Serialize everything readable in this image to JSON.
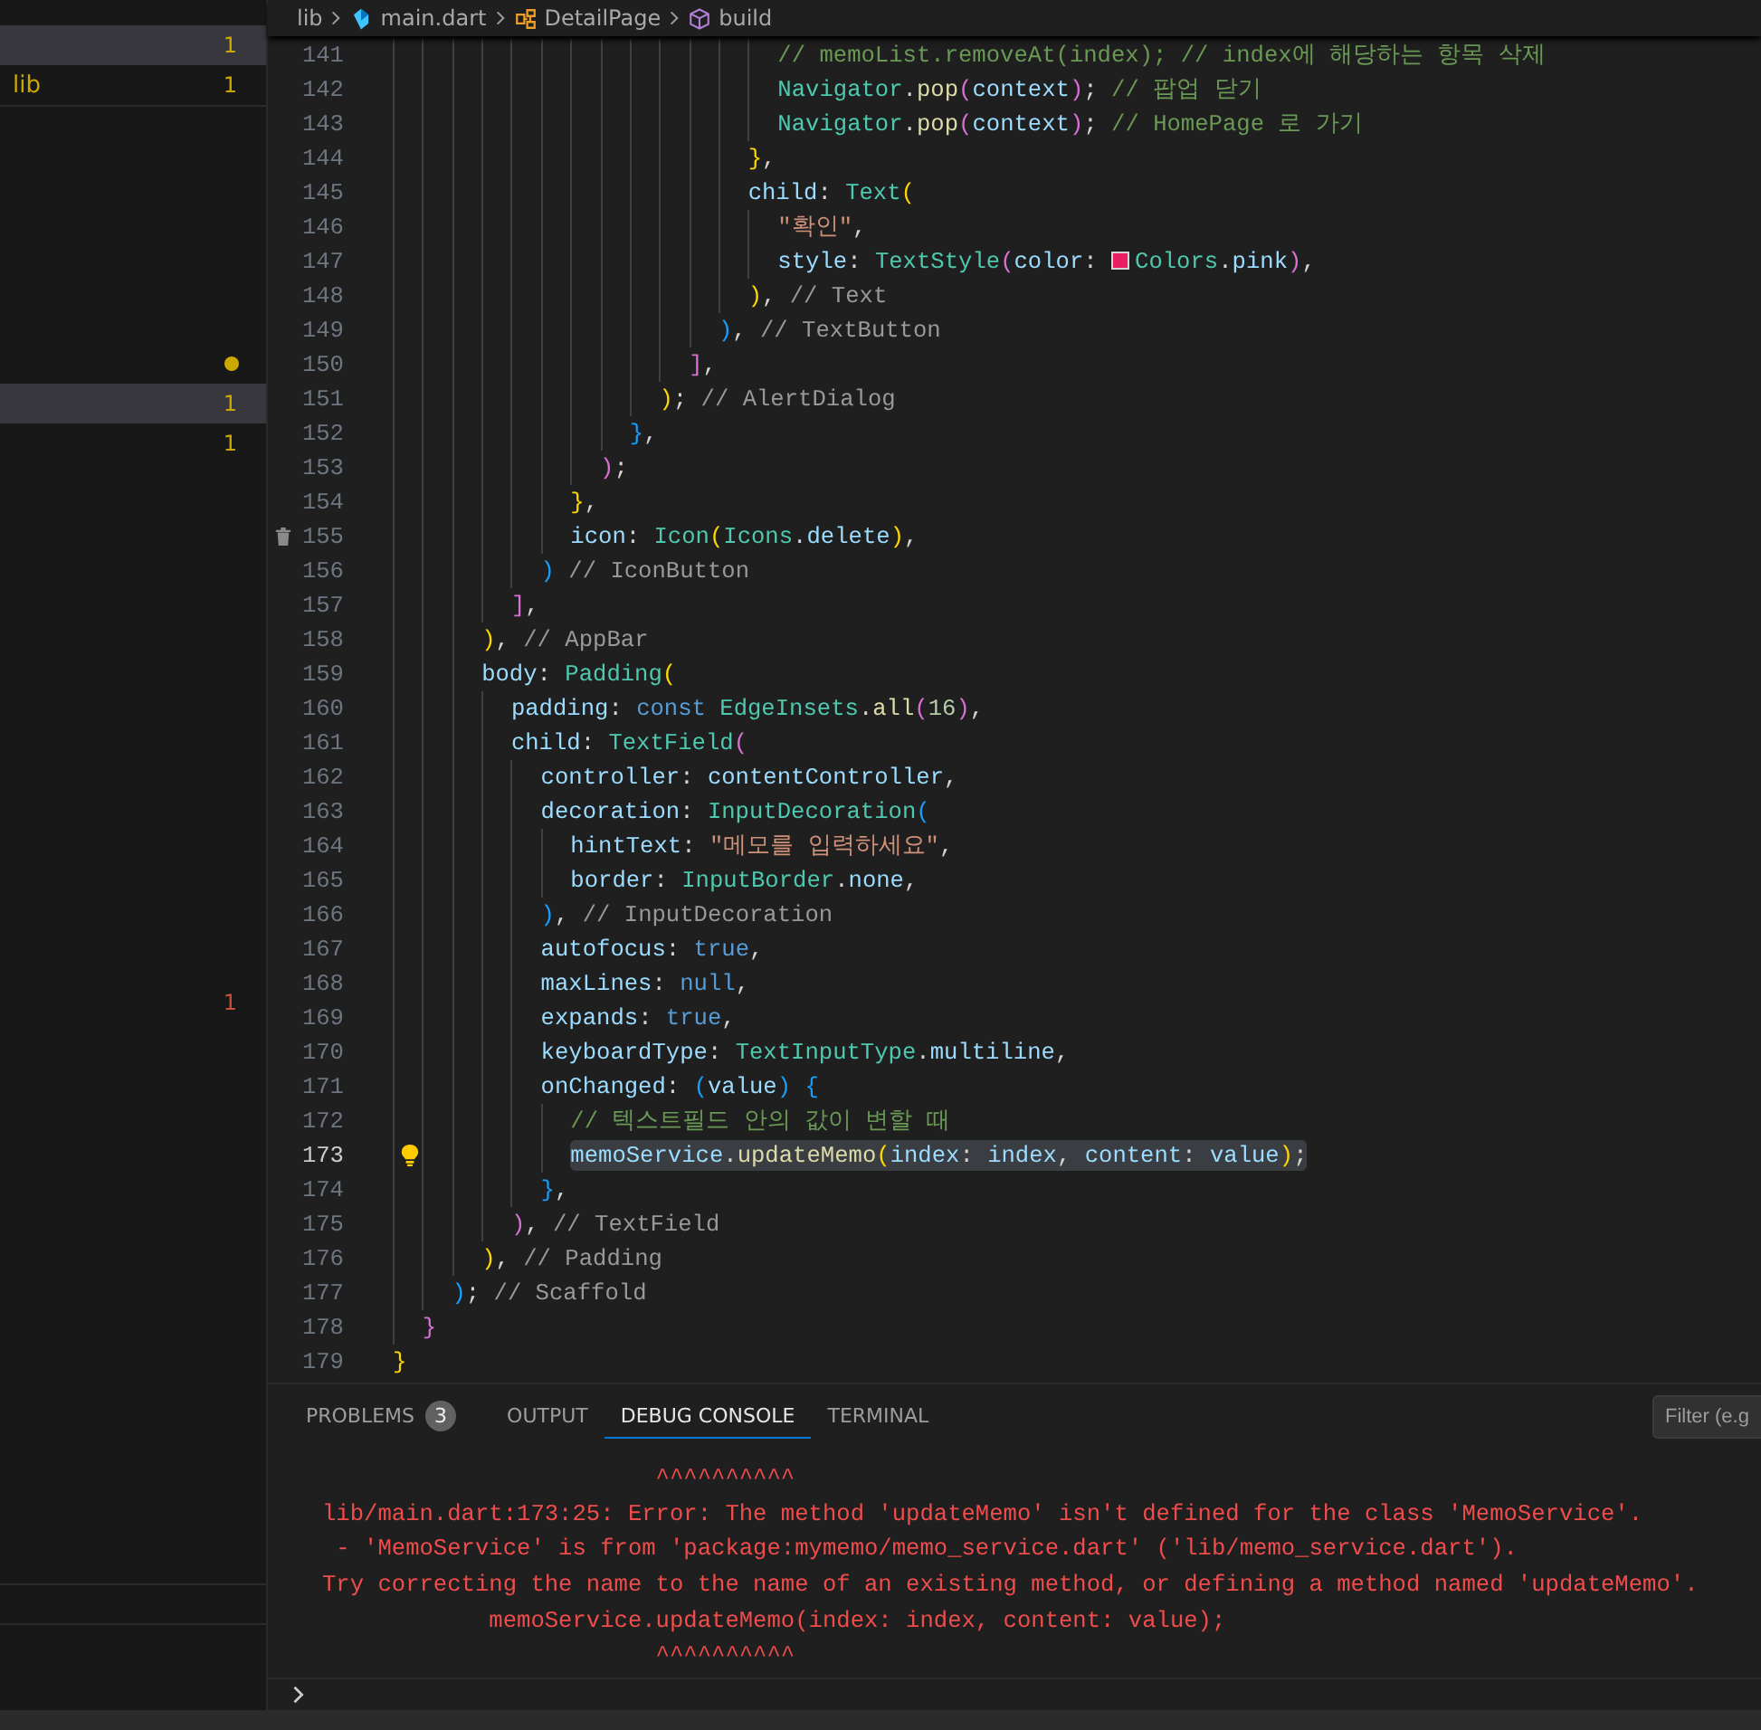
{
  "breadcrumb": [
    {
      "kind": "folder",
      "text": "lib"
    },
    {
      "kind": "file",
      "text": "main.dart"
    },
    {
      "kind": "class",
      "text": "DetailPage"
    },
    {
      "kind": "method",
      "text": "build"
    }
  ],
  "sidebar": {
    "sections": [
      {
        "rows": [
          {
            "kind": "count",
            "badge": "1",
            "color": "#cca700",
            "selected": true
          },
          {
            "kind": "count",
            "label": "lib",
            "badge": "1",
            "color": "#cca700",
            "selected": false
          }
        ]
      },
      {
        "rows": [
          {
            "kind": "dot",
            "color": "#cca700",
            "selected": false
          },
          {
            "kind": "count",
            "badge": "1",
            "color": "#cca700",
            "selected": true
          },
          {
            "kind": "count",
            "badge": "1",
            "color": "#cca700",
            "selected": false
          }
        ]
      },
      {
        "rows": [
          {
            "kind": "count",
            "badge": "1",
            "color": "#c74e39",
            "selected": false
          }
        ]
      }
    ]
  },
  "editor": {
    "lines": [
      {
        "number": "141",
        "selected": false,
        "tokens": [
          {
            "kind": "c",
            "text": "                          // memoList.removeAt(index); // index에 해당하는 항목 삭제"
          }
        ]
      },
      {
        "number": "142",
        "selected": false,
        "tokens": [
          {
            "kind": "t",
            "text": "                          Navigator"
          },
          {
            "kind": "p",
            "text": "."
          },
          {
            "kind": "f",
            "text": "pop"
          },
          {
            "kind": "b2",
            "text": "("
          },
          {
            "kind": "v",
            "text": "context"
          },
          {
            "kind": "b2",
            "text": ")"
          },
          {
            "kind": "p",
            "text": ";"
          },
          {
            "kind": "c",
            "text": " // 팝업 닫기"
          }
        ]
      },
      {
        "number": "143",
        "selected": false,
        "tokens": [
          {
            "kind": "t",
            "text": "                          Navigator"
          },
          {
            "kind": "p",
            "text": "."
          },
          {
            "kind": "f",
            "text": "pop"
          },
          {
            "kind": "b2",
            "text": "("
          },
          {
            "kind": "v",
            "text": "context"
          },
          {
            "kind": "b2",
            "text": ")"
          },
          {
            "kind": "p",
            "text": ";"
          },
          {
            "kind": "c",
            "text": " // HomePage 로 가기"
          }
        ]
      },
      {
        "number": "144",
        "selected": false,
        "tokens": [
          {
            "kind": "b1",
            "text": "                        }"
          },
          {
            "kind": "p",
            "text": ","
          }
        ]
      },
      {
        "number": "145",
        "selected": false,
        "tokens": [
          {
            "kind": "v",
            "text": "                        child"
          },
          {
            "kind": "p",
            "text": ": "
          },
          {
            "kind": "t",
            "text": "Text"
          },
          {
            "kind": "b1",
            "text": "("
          }
        ]
      },
      {
        "number": "146",
        "selected": false,
        "tokens": [
          {
            "kind": "s",
            "text": "                          \"확인\""
          },
          {
            "kind": "p",
            "text": ","
          }
        ]
      },
      {
        "number": "147",
        "selected": false,
        "tokens": [
          {
            "kind": "v",
            "text": "                          style"
          },
          {
            "kind": "p",
            "text": ": "
          },
          {
            "kind": "t",
            "text": "TextStyle"
          },
          {
            "kind": "b2",
            "text": "("
          },
          {
            "kind": "v",
            "text": "color"
          },
          {
            "kind": "p",
            "text": ": "
          },
          {
            "kind": "swatch",
            "color": "#e91e63"
          },
          {
            "kind": "t",
            "text": "Colors"
          },
          {
            "kind": "p",
            "text": "."
          },
          {
            "kind": "v",
            "text": "pink"
          },
          {
            "kind": "b2",
            "text": ")"
          },
          {
            "kind": "p",
            "text": ","
          }
        ]
      },
      {
        "number": "148",
        "selected": false,
        "tokens": [
          {
            "kind": "b1",
            "text": "                        )"
          },
          {
            "kind": "p",
            "text": ","
          },
          {
            "kind": "l",
            "text": " // Text"
          }
        ]
      },
      {
        "number": "149",
        "selected": false,
        "tokens": [
          {
            "kind": "b3",
            "text": "                      )"
          },
          {
            "kind": "p",
            "text": ","
          },
          {
            "kind": "l",
            "text": " // TextButton"
          }
        ]
      },
      {
        "number": "150",
        "selected": false,
        "tokens": [
          {
            "kind": "b2",
            "text": "                    ]"
          },
          {
            "kind": "p",
            "text": ","
          }
        ]
      },
      {
        "number": "151",
        "selected": false,
        "tokens": [
          {
            "kind": "b1",
            "text": "                  )"
          },
          {
            "kind": "p",
            "text": ";"
          },
          {
            "kind": "l",
            "text": " // AlertDialog"
          }
        ]
      },
      {
        "number": "152",
        "selected": false,
        "tokens": [
          {
            "kind": "b3",
            "text": "                }"
          },
          {
            "kind": "p",
            "text": ","
          }
        ]
      },
      {
        "number": "153",
        "selected": false,
        "tokens": [
          {
            "kind": "b2",
            "text": "              )"
          },
          {
            "kind": "p",
            "text": ";"
          }
        ]
      },
      {
        "number": "154",
        "selected": false,
        "tokens": [
          {
            "kind": "b1",
            "text": "            }"
          },
          {
            "kind": "p",
            "text": ","
          }
        ]
      },
      {
        "number": "155",
        "selected": false,
        "gutter": {
          "kind": "trash"
        },
        "tokens": [
          {
            "kind": "v",
            "text": "            icon"
          },
          {
            "kind": "p",
            "text": ": "
          },
          {
            "kind": "t",
            "text": "Icon"
          },
          {
            "kind": "b1",
            "text": "("
          },
          {
            "kind": "t",
            "text": "Icons"
          },
          {
            "kind": "p",
            "text": "."
          },
          {
            "kind": "v",
            "text": "delete"
          },
          {
            "kind": "b1",
            "text": ")"
          },
          {
            "kind": "p",
            "text": ","
          }
        ]
      },
      {
        "number": "156",
        "selected": false,
        "tokens": [
          {
            "kind": "b3",
            "text": "          )"
          },
          {
            "kind": "l",
            "text": " // IconButton"
          }
        ]
      },
      {
        "number": "157",
        "selected": false,
        "tokens": [
          {
            "kind": "b2",
            "text": "        ]"
          },
          {
            "kind": "p",
            "text": ","
          }
        ]
      },
      {
        "number": "158",
        "selected": false,
        "tokens": [
          {
            "kind": "b1",
            "text": "      )"
          },
          {
            "kind": "p",
            "text": ","
          },
          {
            "kind": "l",
            "text": " // AppBar"
          }
        ]
      },
      {
        "number": "159",
        "selected": false,
        "tokens": [
          {
            "kind": "v",
            "text": "      body"
          },
          {
            "kind": "p",
            "text": ": "
          },
          {
            "kind": "t",
            "text": "Padding"
          },
          {
            "kind": "b1",
            "text": "("
          }
        ]
      },
      {
        "number": "160",
        "selected": false,
        "tokens": [
          {
            "kind": "v",
            "text": "        padding"
          },
          {
            "kind": "p",
            "text": ": "
          },
          {
            "kind": "k",
            "text": "const "
          },
          {
            "kind": "t",
            "text": "EdgeInsets"
          },
          {
            "kind": "p",
            "text": "."
          },
          {
            "kind": "f",
            "text": "all"
          },
          {
            "kind": "b2",
            "text": "("
          },
          {
            "kind": "n",
            "text": "16"
          },
          {
            "kind": "b2",
            "text": ")"
          },
          {
            "kind": "p",
            "text": ","
          }
        ]
      },
      {
        "number": "161",
        "selected": false,
        "tokens": [
          {
            "kind": "v",
            "text": "        child"
          },
          {
            "kind": "p",
            "text": ": "
          },
          {
            "kind": "t",
            "text": "TextField"
          },
          {
            "kind": "b2",
            "text": "("
          }
        ]
      },
      {
        "number": "162",
        "selected": false,
        "tokens": [
          {
            "kind": "v",
            "text": "          controller"
          },
          {
            "kind": "p",
            "text": ": "
          },
          {
            "kind": "v",
            "text": "contentController"
          },
          {
            "kind": "p",
            "text": ","
          }
        ]
      },
      {
        "number": "163",
        "selected": false,
        "tokens": [
          {
            "kind": "v",
            "text": "          decoration"
          },
          {
            "kind": "p",
            "text": ": "
          },
          {
            "kind": "t",
            "text": "InputDecoration"
          },
          {
            "kind": "b3",
            "text": "("
          }
        ]
      },
      {
        "number": "164",
        "selected": false,
        "tokens": [
          {
            "kind": "v",
            "text": "            hintText"
          },
          {
            "kind": "p",
            "text": ": "
          },
          {
            "kind": "s",
            "text": "\"메모를 입력하세요\""
          },
          {
            "kind": "p",
            "text": ","
          }
        ]
      },
      {
        "number": "165",
        "selected": false,
        "tokens": [
          {
            "kind": "v",
            "text": "            border"
          },
          {
            "kind": "p",
            "text": ": "
          },
          {
            "kind": "t",
            "text": "InputBorder"
          },
          {
            "kind": "p",
            "text": "."
          },
          {
            "kind": "v",
            "text": "none"
          },
          {
            "kind": "p",
            "text": ","
          }
        ]
      },
      {
        "number": "166",
        "selected": false,
        "tokens": [
          {
            "kind": "b3",
            "text": "          )"
          },
          {
            "kind": "p",
            "text": ","
          },
          {
            "kind": "l",
            "text": " // InputDecoration"
          }
        ]
      },
      {
        "number": "167",
        "selected": false,
        "tokens": [
          {
            "kind": "v",
            "text": "          autofocus"
          },
          {
            "kind": "p",
            "text": ": "
          },
          {
            "kind": "k",
            "text": "true"
          },
          {
            "kind": "p",
            "text": ","
          }
        ]
      },
      {
        "number": "168",
        "selected": false,
        "tokens": [
          {
            "kind": "v",
            "text": "          maxLines"
          },
          {
            "kind": "p",
            "text": ": "
          },
          {
            "kind": "k",
            "text": "null"
          },
          {
            "kind": "p",
            "text": ","
          }
        ]
      },
      {
        "number": "169",
        "selected": false,
        "tokens": [
          {
            "kind": "v",
            "text": "          expands"
          },
          {
            "kind": "p",
            "text": ": "
          },
          {
            "kind": "k",
            "text": "true"
          },
          {
            "kind": "p",
            "text": ","
          }
        ]
      },
      {
        "number": "170",
        "selected": false,
        "tokens": [
          {
            "kind": "v",
            "text": "          keyboardType"
          },
          {
            "kind": "p",
            "text": ": "
          },
          {
            "kind": "t",
            "text": "TextInputType"
          },
          {
            "kind": "p",
            "text": "."
          },
          {
            "kind": "v",
            "text": "multiline"
          },
          {
            "kind": "p",
            "text": ","
          }
        ]
      },
      {
        "number": "171",
        "selected": false,
        "tokens": [
          {
            "kind": "v",
            "text": "          onChanged"
          },
          {
            "kind": "p",
            "text": ": "
          },
          {
            "kind": "b3",
            "text": "("
          },
          {
            "kind": "v",
            "text": "value"
          },
          {
            "kind": "b3",
            "text": ") {"
          }
        ]
      },
      {
        "number": "172",
        "selected": false,
        "tokens": [
          {
            "kind": "c",
            "text": "            // 텍스트필드 안의 값이 변할 때"
          }
        ]
      },
      {
        "number": "173",
        "selected": true,
        "gutter": {
          "kind": "lightbulb"
        },
        "tokens": [
          {
            "kind": "v",
            "text": "            memoService"
          },
          {
            "kind": "p",
            "text": "."
          },
          {
            "kind": "f",
            "text": "updateMemo"
          },
          {
            "kind": "b1",
            "text": "("
          },
          {
            "kind": "v",
            "text": "index"
          },
          {
            "kind": "p",
            "text": ": "
          },
          {
            "kind": "v",
            "text": "index"
          },
          {
            "kind": "p",
            "text": ", "
          },
          {
            "kind": "v",
            "text": "content"
          },
          {
            "kind": "p",
            "text": ": "
          },
          {
            "kind": "v",
            "text": "value"
          },
          {
            "kind": "b1",
            "text": ")"
          },
          {
            "kind": "p",
            "text": ";"
          }
        ]
      },
      {
        "number": "174",
        "selected": false,
        "tokens": [
          {
            "kind": "b3",
            "text": "          }"
          },
          {
            "kind": "p",
            "text": ","
          }
        ]
      },
      {
        "number": "175",
        "selected": false,
        "tokens": [
          {
            "kind": "b2",
            "text": "        )"
          },
          {
            "kind": "p",
            "text": ","
          },
          {
            "kind": "l",
            "text": " // TextField"
          }
        ]
      },
      {
        "number": "176",
        "selected": false,
        "tokens": [
          {
            "kind": "b1",
            "text": "      )"
          },
          {
            "kind": "p",
            "text": ","
          },
          {
            "kind": "l",
            "text": " // Padding"
          }
        ]
      },
      {
        "number": "177",
        "selected": false,
        "tokens": [
          {
            "kind": "b3",
            "text": "    )"
          },
          {
            "kind": "p",
            "text": ";"
          },
          {
            "kind": "l",
            "text": " // Scaffold"
          }
        ]
      },
      {
        "number": "178",
        "selected": false,
        "tokens": [
          {
            "kind": "b2",
            "text": "  }"
          }
        ]
      },
      {
        "number": "179",
        "selected": false,
        "tokens": [
          {
            "kind": "b1",
            "text": "}"
          }
        ]
      }
    ]
  },
  "panel": {
    "tabs": [
      {
        "text": "PROBLEMS",
        "badge": "3",
        "selected": false
      },
      {
        "text": "OUTPUT",
        "selected": false
      },
      {
        "text": "DEBUG CONSOLE",
        "selected": true
      },
      {
        "text": "TERMINAL",
        "selected": false
      }
    ],
    "filter": {
      "placeholder": "Filter (e.g"
    },
    "console_lines": [
      "                        ^^^^^^^^^^",
      "lib/main.dart:173:25: Error: The method 'updateMemo' isn't defined for the class 'MemoService'.",
      " - 'MemoService' is from 'package:mymemo/memo_service.dart' ('lib/memo_service.dart').",
      "Try correcting the name to the name of an existing method, or defining a method named 'updateMemo'.",
      "            memoService.updateMemo(index: index, content: value);",
      "                        ^^^^^^^^^^"
    ]
  }
}
